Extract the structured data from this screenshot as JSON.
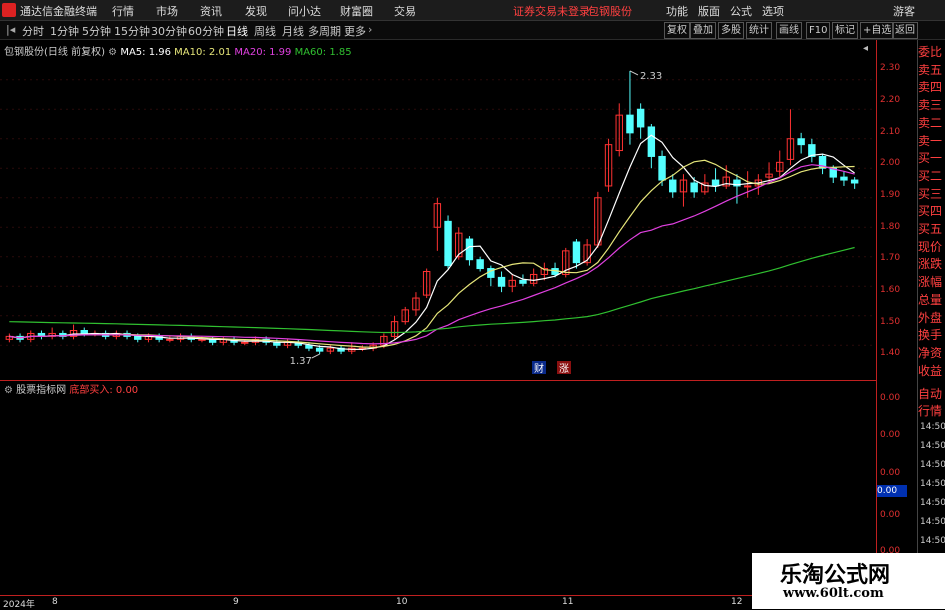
{
  "menubar": {
    "app_name": "通达信金融终端",
    "items": [
      "行情",
      "市场",
      "资讯",
      "发现",
      "问小达",
      "财富圈",
      "交易"
    ],
    "notice": "证券交易未登录",
    "stock_link": "包钢股份",
    "right_items": [
      "功能",
      "版面",
      "公式",
      "选项"
    ],
    "guest": "游客"
  },
  "toolbar": {
    "periods": [
      "分时",
      "1分钟",
      "5分钟",
      "15分钟",
      "30分钟",
      "60分钟",
      "日线",
      "周线",
      "月线",
      "多周期",
      "更多"
    ],
    "active_period": "日线",
    "right_buttons": [
      "复权",
      "叠加",
      "多股",
      "统计",
      "画线",
      "F10",
      "标记",
      "+自选",
      "返回"
    ]
  },
  "main_chart": {
    "stock_title": "包钢股份(日线 前复权)",
    "ma5_label": "MA5: 1.96",
    "ma10_label": "MA10: 2.01",
    "ma20_label": "MA20: 1.99",
    "ma60_label": "MA60: 1.85",
    "high_mark": "2.33",
    "low_mark": "1.37",
    "badge_cai": "财",
    "badge_zhang": "涨"
  },
  "indicator_panel": {
    "name": "股票指标网",
    "series_label": "底部买入:",
    "series_value": "0.00",
    "current_value": "0.00"
  },
  "right_panel": {
    "quote_labels": [
      "委比",
      "卖五",
      "卖四",
      "卖三",
      "卖二",
      "卖一",
      "买一",
      "买二",
      "买三",
      "买四",
      "买五",
      "现价",
      "涨跌",
      "涨幅",
      "总量",
      "外盘",
      "换手",
      "净资",
      "收益"
    ],
    "tabs": [
      "自动",
      "行情"
    ],
    "times": [
      "14:50",
      "14:50",
      "14:50",
      "14:50",
      "14:50",
      "14:50",
      "14:50",
      "14:50"
    ]
  },
  "chart_data": {
    "type": "candlestick",
    "y_axis_ticks": [
      "2.30",
      "2.20",
      "2.10",
      "2.00",
      "1.90",
      "1.80",
      "1.70",
      "1.60",
      "1.50",
      "1.40"
    ],
    "ylim": [
      1.35,
      2.35
    ],
    "indicator_axis_ticks": [
      "0.00",
      "0.00",
      "0.00",
      "0.00",
      "0.00"
    ],
    "x_axis_labels": [
      "2024年",
      "8",
      "9",
      "10",
      "11",
      "12"
    ],
    "colors": {
      "up": "#ff3232",
      "down": "#54ffff",
      "ma5": "#ffffff",
      "ma10": "#e6e67a",
      "ma20": "#e040e0",
      "ma60": "#30c030"
    },
    "candles": [
      [
        1.42,
        1.43,
        1.41,
        1.44
      ],
      [
        1.43,
        1.42,
        1.41,
        1.44
      ],
      [
        1.42,
        1.44,
        1.41,
        1.45
      ],
      [
        1.44,
        1.43,
        1.42,
        1.45
      ],
      [
        1.43,
        1.44,
        1.42,
        1.46
      ],
      [
        1.44,
        1.43,
        1.42,
        1.45
      ],
      [
        1.43,
        1.45,
        1.42,
        1.47
      ],
      [
        1.45,
        1.44,
        1.43,
        1.46
      ],
      [
        1.44,
        1.44,
        1.43,
        1.45
      ],
      [
        1.44,
        1.43,
        1.42,
        1.45
      ],
      [
        1.43,
        1.44,
        1.42,
        1.45
      ],
      [
        1.44,
        1.43,
        1.42,
        1.45
      ],
      [
        1.43,
        1.42,
        1.41,
        1.44
      ],
      [
        1.42,
        1.43,
        1.41,
        1.44
      ],
      [
        1.43,
        1.42,
        1.41,
        1.44
      ],
      [
        1.42,
        1.42,
        1.41,
        1.43
      ],
      [
        1.42,
        1.43,
        1.41,
        1.44
      ],
      [
        1.43,
        1.42,
        1.41,
        1.44
      ],
      [
        1.42,
        1.42,
        1.41,
        1.43
      ],
      [
        1.42,
        1.41,
        1.4,
        1.43
      ],
      [
        1.41,
        1.42,
        1.4,
        1.43
      ],
      [
        1.42,
        1.41,
        1.4,
        1.43
      ],
      [
        1.41,
        1.41,
        1.4,
        1.42
      ],
      [
        1.41,
        1.42,
        1.4,
        1.43
      ],
      [
        1.42,
        1.41,
        1.4,
        1.43
      ],
      [
        1.41,
        1.4,
        1.39,
        1.42
      ],
      [
        1.4,
        1.41,
        1.39,
        1.42
      ],
      [
        1.41,
        1.4,
        1.39,
        1.42
      ],
      [
        1.4,
        1.39,
        1.38,
        1.41
      ],
      [
        1.39,
        1.38,
        1.37,
        1.4
      ],
      [
        1.38,
        1.39,
        1.37,
        1.4
      ],
      [
        1.39,
        1.38,
        1.37,
        1.4
      ],
      [
        1.38,
        1.39,
        1.37,
        1.41
      ],
      [
        1.39,
        1.39,
        1.38,
        1.4
      ],
      [
        1.39,
        1.4,
        1.38,
        1.41
      ],
      [
        1.4,
        1.43,
        1.39,
        1.44
      ],
      [
        1.43,
        1.48,
        1.42,
        1.5
      ],
      [
        1.48,
        1.52,
        1.47,
        1.53
      ],
      [
        1.52,
        1.56,
        1.5,
        1.58
      ],
      [
        1.57,
        1.65,
        1.56,
        1.66
      ],
      [
        1.8,
        1.88,
        1.72,
        1.9
      ],
      [
        1.82,
        1.67,
        1.66,
        1.84
      ],
      [
        1.7,
        1.78,
        1.69,
        1.8
      ],
      [
        1.76,
        1.69,
        1.67,
        1.77
      ],
      [
        1.69,
        1.66,
        1.65,
        1.7
      ],
      [
        1.66,
        1.63,
        1.6,
        1.67
      ],
      [
        1.63,
        1.6,
        1.58,
        1.65
      ],
      [
        1.6,
        1.62,
        1.58,
        1.64
      ],
      [
        1.62,
        1.61,
        1.6,
        1.64
      ],
      [
        1.61,
        1.64,
        1.6,
        1.66
      ],
      [
        1.64,
        1.66,
        1.62,
        1.68
      ],
      [
        1.66,
        1.64,
        1.63,
        1.68
      ],
      [
        1.64,
        1.72,
        1.63,
        1.73
      ],
      [
        1.75,
        1.68,
        1.66,
        1.76
      ],
      [
        1.68,
        1.74,
        1.67,
        1.76
      ],
      [
        1.74,
        1.9,
        1.73,
        1.92
      ],
      [
        1.94,
        2.08,
        1.92,
        2.1
      ],
      [
        2.06,
        2.18,
        2.04,
        2.22
      ],
      [
        2.18,
        2.12,
        2.08,
        2.33
      ],
      [
        2.2,
        2.14,
        2.1,
        2.22
      ],
      [
        2.14,
        2.04,
        2.0,
        2.15
      ],
      [
        2.04,
        1.96,
        1.94,
        2.06
      ],
      [
        1.96,
        1.92,
        1.9,
        1.98
      ],
      [
        1.92,
        1.96,
        1.87,
        1.98
      ],
      [
        1.95,
        1.92,
        1.9,
        1.97
      ],
      [
        1.92,
        1.95,
        1.91,
        1.98
      ],
      [
        1.96,
        1.94,
        1.92,
        2.0
      ],
      [
        1.94,
        1.97,
        1.93,
        2.01
      ],
      [
        1.96,
        1.94,
        1.88,
        1.98
      ],
      [
        1.94,
        1.94,
        1.9,
        1.99
      ],
      [
        1.94,
        1.96,
        1.91,
        1.98
      ],
      [
        1.97,
        1.98,
        1.95,
        2.02
      ],
      [
        1.99,
        2.02,
        1.97,
        2.06
      ],
      [
        2.03,
        2.1,
        2.01,
        2.2
      ],
      [
        2.1,
        2.08,
        2.05,
        2.12
      ],
      [
        2.08,
        2.04,
        2.02,
        2.1
      ],
      [
        2.04,
        2.0,
        1.98,
        2.05
      ],
      [
        2.0,
        1.97,
        1.95,
        2.01
      ],
      [
        1.97,
        1.96,
        1.94,
        1.99
      ],
      [
        1.96,
        1.95,
        1.93,
        1.97
      ]
    ]
  }
}
